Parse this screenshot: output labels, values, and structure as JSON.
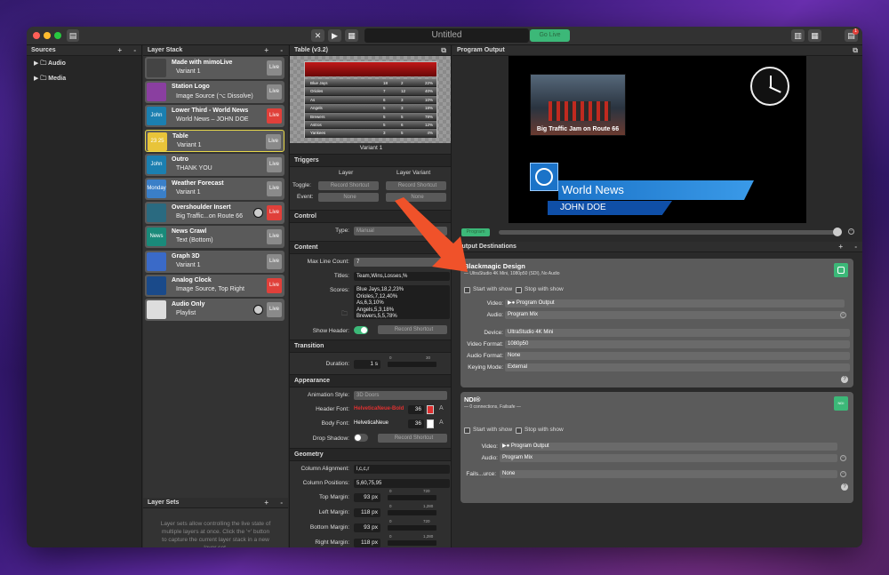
{
  "window": {
    "title": "Untitled",
    "go_live_label": "Go Live"
  },
  "sources": {
    "header": "Sources",
    "items": [
      {
        "label": "Audio"
      },
      {
        "label": "Media"
      }
    ]
  },
  "layer_stack": {
    "header": "Layer Stack",
    "layers": [
      {
        "name": "Made with mimoLive",
        "sub": "Variant 1",
        "state": "Live",
        "on": false,
        "thumb_color": "#444"
      },
      {
        "name": "Station Logo",
        "sub": "Image Source (⌥ Dissolve)",
        "state": "Live",
        "on": false,
        "thumb_color": "#8a3fa0"
      },
      {
        "name": "Lower Third - World News",
        "sub": "World News – JOHN DOE",
        "state": "Live",
        "on": true,
        "thumb_color": "#1b7fb0",
        "thumb_text": "John Doe"
      },
      {
        "name": "Table",
        "sub": "Variant 1",
        "state": "Live",
        "on": false,
        "thumb_color": "#e8c43a",
        "thumb_text": "23 25\n43 18"
      },
      {
        "name": "Outro",
        "sub": "THANK YOU",
        "state": "Live",
        "on": false,
        "thumb_color": "#1b7fb0",
        "thumb_text": "John Doe"
      },
      {
        "name": "Weather Forecast",
        "sub": "Variant 1",
        "state": "Live",
        "on": false,
        "thumb_color": "#3a7fc8",
        "thumb_text": "Monday"
      },
      {
        "name": "Overshoulder Insert",
        "sub": "Big Traffic...on Route 66",
        "state": "Live",
        "on": true,
        "thumb_color": "#2a6a80"
      },
      {
        "name": "News Crawl",
        "sub": "Text (Bottom)",
        "state": "Live",
        "on": false,
        "thumb_color": "#1a8a7a",
        "thumb_text": "News"
      },
      {
        "name": "Graph 3D",
        "sub": "Variant 1",
        "state": "Live",
        "on": false,
        "thumb_color": "#3a6ac8"
      },
      {
        "name": "Analog Clock",
        "sub": "Image Source, Top Right",
        "state": "Live",
        "on": true,
        "thumb_color": "#1a4a8a"
      },
      {
        "name": "Audio Only",
        "sub": "Playlist",
        "state": "Live",
        "on": false,
        "thumb_color": "#ddd"
      }
    ],
    "layer_sets_header": "Layer Sets",
    "layer_sets_hint": "Layer sets allow controlling the live state of multiple layers at once. Click the '+' button to capture the current layer stack in a new layer set."
  },
  "table_panel": {
    "header": "Table (v3.2)",
    "variant": "Variant 1",
    "preview_rows": [
      {
        "team": "Blue Jays",
        "a": "18",
        "b": "2",
        "c": "22%"
      },
      {
        "team": "Orioles",
        "a": "7",
        "b": "12",
        "c": "40%"
      },
      {
        "team": "As",
        "a": "6",
        "b": "3",
        "c": "10%"
      },
      {
        "team": "Angels",
        "a": "5",
        "b": "3",
        "c": "18%"
      },
      {
        "team": "Brewers",
        "a": "5",
        "b": "5",
        "c": "78%"
      },
      {
        "team": "Astros",
        "a": "5",
        "b": "6",
        "c": "12%"
      },
      {
        "team": "Yankees",
        "a": "3",
        "b": "5",
        "c": "4%"
      }
    ],
    "triggers": {
      "header": "Triggers",
      "col1": "Layer",
      "col2": "Layer Variant",
      "toggle_label": "Toggle:",
      "record_shortcut": "Record Shortcut",
      "event_label": "Event:",
      "event_value": "None",
      "variant_event_value": "None"
    },
    "control": {
      "header": "Control",
      "type_label": "Type:",
      "type_value": "Manual"
    },
    "content": {
      "header": "Content",
      "max_line_label": "Max Line Count:",
      "max_line_value": "7",
      "titles_label": "Titles:",
      "titles_value": "Team,Wins,Losses,%",
      "scores_label": "Scores:",
      "scores_lines": [
        "Blue Jays,18,2,23%",
        "Orioles,7,12,40%",
        "As,6,3,10%",
        "Angels,5,3,18%",
        "Brewers,5,5,78%"
      ],
      "show_header_label": "Show Header:",
      "record_shortcut": "Record Shortcut"
    },
    "transition": {
      "header": "Transition",
      "duration_label": "Duration:",
      "duration_value": "1 s",
      "slider_min": "0",
      "slider_max": "30"
    },
    "appearance": {
      "header": "Appearance",
      "anim_label": "Animation Style:",
      "anim_value": "3D Doors",
      "header_font_label": "Header Font:",
      "header_font_value": "HelveticaNeue-Bold",
      "header_font_size": "36",
      "body_font_label": "Body Font:",
      "body_font_value": "HelveticaNeue",
      "body_font_size": "36",
      "drop_shadow_label": "Drop Shadow:",
      "record_shortcut": "Record Shortcut"
    },
    "geometry": {
      "header": "Geometry",
      "col_align_label": "Column Alignment:",
      "col_align_value": "l,c,c,r",
      "col_pos_label": "Column Positions:",
      "col_pos_value": "5,60,75,95",
      "top_margin_label": "Top Margin:",
      "top_margin_value": "93 px",
      "top_max": "720",
      "left_margin_label": "Left Margin:",
      "left_margin_value": "118 px",
      "left_max": "1,280",
      "bottom_margin_label": "Bottom Margin:",
      "bottom_margin_value": "93 px",
      "bottom_max": "720",
      "right_margin_label": "Right Margin:",
      "right_margin_value": "118 px",
      "right_max": "1,280",
      "slider_min": "0"
    }
  },
  "program_output": {
    "header": "Program Output",
    "news_title": "World News",
    "news_name": "JOHN DOE",
    "caption": "Big Traffic Jam on Route 66",
    "program_label": "Program"
  },
  "output_destinations": {
    "header": "Output Destinations",
    "blackmagic": {
      "title": "Blackmagic Design",
      "subtitle": "— UltraStudio 4K Mini, 1080p50 (SDI), No Audio",
      "start_label": "Start with show",
      "stop_label": "Stop with show",
      "video_label": "Video:",
      "video_value": "▶● Program Output",
      "audio_label": "Audio:",
      "audio_value": "Program Mix",
      "device_label": "Device:",
      "device_value": "UltraStudio 4K Mini",
      "vformat_label": "Video Format:",
      "vformat_value": "1080p50",
      "aformat_label": "Audio Format:",
      "aformat_value": "None",
      "keying_label": "Keying Mode:",
      "keying_value": "External"
    },
    "ndi": {
      "title": "NDI®",
      "subtitle": "— 0 connections, Failsafe —",
      "start_label": "Start with show",
      "stop_label": "Stop with show",
      "video_label": "Video:",
      "video_value": "▶● Program Output",
      "audio_label": "Audio:",
      "audio_value": "Program Mix",
      "fails_label": "Fails...urce:",
      "fails_value": "None",
      "badge": "NDI"
    }
  },
  "colors": {
    "accent_green": "#3cb878",
    "live_red": "#e0403a",
    "news_blue": "#1b73c8",
    "arrow": "#f0522a"
  }
}
